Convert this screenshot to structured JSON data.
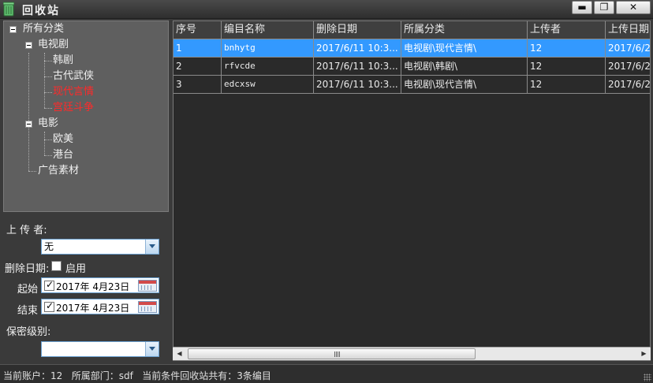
{
  "window": {
    "title": "回收站",
    "icon": "recycle-bin-icon",
    "controls": {
      "minimize": "▬",
      "maximize": "❐",
      "close": "✕"
    }
  },
  "tree": {
    "root": "所有分类",
    "groups": [
      {
        "label": "电视剧",
        "children": [
          {
            "label": "韩剧",
            "highlight": false
          },
          {
            "label": "古代武侠",
            "highlight": false
          },
          {
            "label": "现代言情",
            "highlight": true
          },
          {
            "label": "宫廷斗争",
            "highlight": true
          }
        ]
      },
      {
        "label": "电影",
        "children": [
          {
            "label": "欧美",
            "highlight": false
          },
          {
            "label": "港台",
            "highlight": false
          }
        ]
      },
      {
        "label": "广告素材",
        "children": []
      }
    ],
    "highlight_color": "#ff2a2a"
  },
  "filters": {
    "uploader_label": "上 传 者:",
    "uploader_value": "无",
    "delete_date_label": "删除日期:",
    "enable_label": "启用",
    "enable_checked": false,
    "start_label": "起始",
    "start_date": "2017年  4月23日",
    "start_checked": true,
    "end_label": "结束",
    "end_date": "2017年  4月23日",
    "end_checked": true,
    "security_label": "保密级别:",
    "security_value": ""
  },
  "grid": {
    "columns": [
      "序号",
      "编目名称",
      "删除日期",
      "所属分类",
      "上传者",
      "上传日期"
    ],
    "rows": [
      {
        "no": "1",
        "name": "bnhytg",
        "deleted": "2017/6/11 10:3...",
        "category": "电视剧\\现代言情\\",
        "uploader": "12",
        "uploaded": "2017/6/2",
        "selected": true
      },
      {
        "no": "2",
        "name": "rfvcde",
        "deleted": "2017/6/11 10:3...",
        "category": "电视剧\\韩剧\\",
        "uploader": "12",
        "uploaded": "2017/6/2",
        "selected": false
      },
      {
        "no": "3",
        "name": "edcxsw",
        "deleted": "2017/6/11 10:3...",
        "category": "电视剧\\现代言情\\",
        "uploader": "12",
        "uploaded": "2017/6/2",
        "selected": false
      }
    ],
    "selected_color": "#3399ff",
    "scrollbar": {
      "left_arrow": "◀",
      "right_arrow": "▶"
    }
  },
  "status": {
    "text": "当前账户：12   所属部门：sdf   当前条件回收站共有：3条编目"
  }
}
